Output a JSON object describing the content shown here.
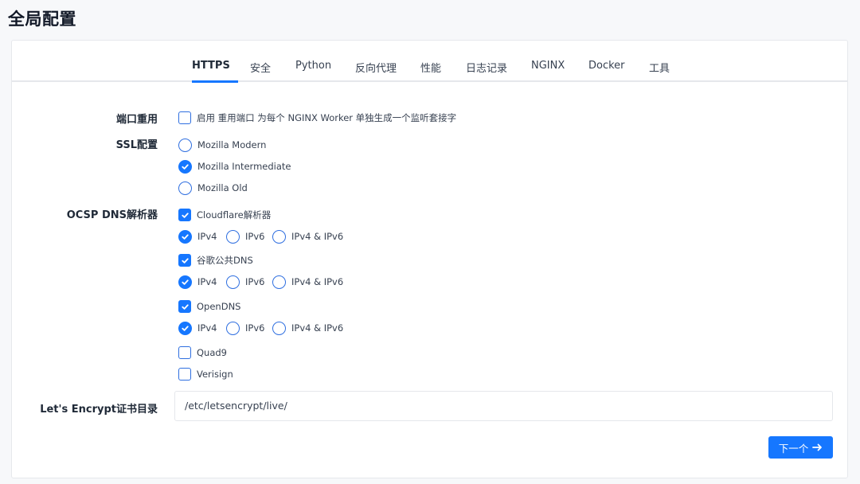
{
  "page_title": "全局配置",
  "tabs": [
    {
      "label": "HTTPS",
      "active": true
    },
    {
      "label": "安全",
      "active": false
    },
    {
      "label": "Python",
      "active": false
    },
    {
      "label": "反向代理",
      "active": false
    },
    {
      "label": "性能",
      "active": false
    },
    {
      "label": "日志记录",
      "active": false
    },
    {
      "label": "NGINX",
      "active": false
    },
    {
      "label": "Docker",
      "active": false
    },
    {
      "label": "工具",
      "active": false
    }
  ],
  "port_reuse": {
    "label": "端口重用",
    "option_label": "启用 重用端口 为每个 NGINX Worker 单独生成一个监听套接字",
    "checked": false
  },
  "ssl_config": {
    "label": "SSL配置",
    "options": [
      {
        "label": "Mozilla Modern",
        "selected": false
      },
      {
        "label": "Mozilla Intermediate",
        "selected": true
      },
      {
        "label": "Mozilla Old",
        "selected": false
      }
    ]
  },
  "ocsp": {
    "label": "OCSP DNS解析器",
    "resolvers": [
      {
        "label": "Cloudflare解析器",
        "checked": true,
        "ip_options": [
          "IPv4",
          "IPv6",
          "IPv4 & IPv6"
        ],
        "ip_selected": "IPv4"
      },
      {
        "label": "谷歌公共DNS",
        "checked": true,
        "ip_options": [
          "IPv4",
          "IPv6",
          "IPv4 & IPv6"
        ],
        "ip_selected": "IPv4"
      },
      {
        "label": "OpenDNS",
        "checked": true,
        "ip_options": [
          "IPv4",
          "IPv6",
          "IPv4 & IPv6"
        ],
        "ip_selected": "IPv4"
      },
      {
        "label": "Quad9",
        "checked": false
      },
      {
        "label": "Verisign",
        "checked": false
      }
    ]
  },
  "letsencrypt": {
    "label": "Let's Encrypt证书目录",
    "value": "/etc/letsencrypt/live/"
  },
  "next_button": {
    "label": "下一个"
  },
  "colors": {
    "accent": "#1677ff"
  }
}
